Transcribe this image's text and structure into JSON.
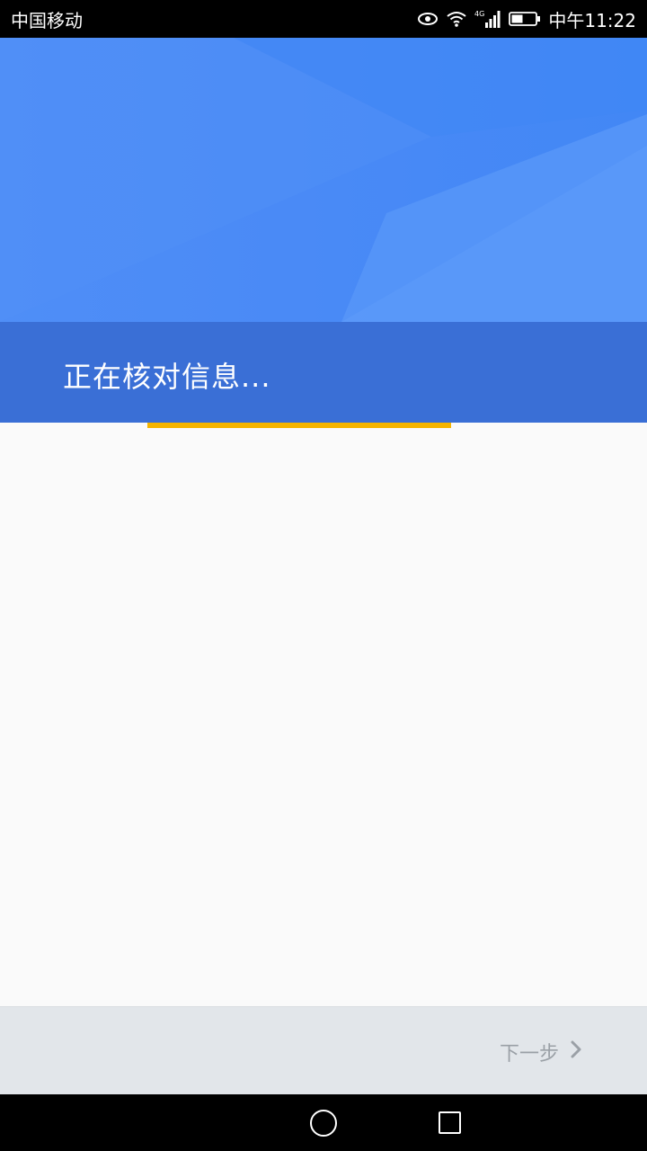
{
  "status_bar": {
    "carrier": "中国移动",
    "time": "中午11:22",
    "icons": [
      "eye-icon",
      "wifi-icon",
      "signal-4g-icon",
      "battery-icon"
    ]
  },
  "header": {
    "title": "正在核对信息..."
  },
  "progress": {
    "fraction": 0.47,
    "color": "#f4b400"
  },
  "footer": {
    "next_label": "下一步"
  },
  "colors": {
    "header_blue": "#4287f5",
    "title_band": "#3a6fd6",
    "footer_bg": "#e2e6ea",
    "next_text": "#9aa0a6"
  }
}
